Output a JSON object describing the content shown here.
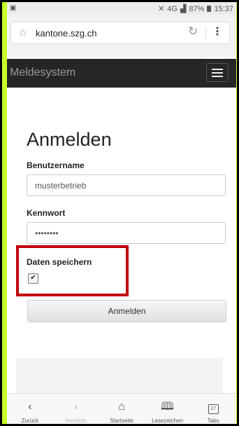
{
  "status_bar": {
    "signal_text": "4G",
    "battery": "87%",
    "time": "15:37"
  },
  "browser": {
    "url": "kantone.szg.ch"
  },
  "navbar": {
    "brand": "Meldesystem"
  },
  "form": {
    "title": "Anmelden",
    "username_label": "Benutzername",
    "username_value": "musterbetrieb",
    "password_label": "Kennwort",
    "password_value": "••••••••",
    "remember_label": "Daten speichern",
    "remember_checked": true,
    "submit_label": "Anmelden"
  },
  "toolbar": {
    "items": [
      {
        "label": "Zurück",
        "icon": "back-icon"
      },
      {
        "label": "Vorwärts",
        "icon": "forward-icon"
      },
      {
        "label": "Startseite",
        "icon": "home-icon"
      },
      {
        "label": "Lesezeichen",
        "icon": "bookmarks-icon"
      },
      {
        "label": "Tabs",
        "icon": "tabs-icon",
        "count": "17"
      }
    ]
  },
  "colors": {
    "frame_background": "#c8ff2a",
    "navbar_background": "#262626",
    "highlight": "#c0000c"
  }
}
